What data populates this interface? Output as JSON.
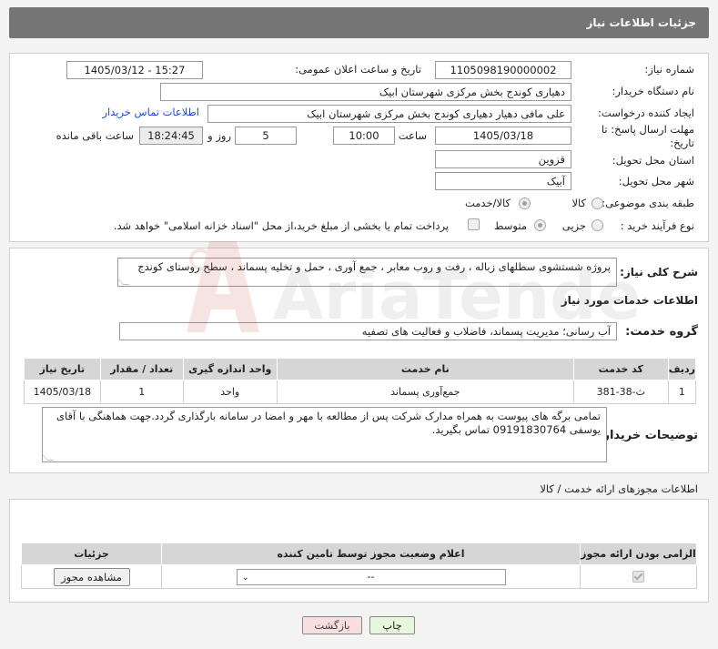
{
  "header": {
    "title": "جزئیات اطلاعات نیاز"
  },
  "form": {
    "need_number_label": "شماره نیاز:",
    "need_number": "1105098190000002",
    "announce_label": "تاریخ و ساعت اعلان عمومی:",
    "announce_value": "1405/03/12 - 15:27",
    "buyer_org_label": "نام دستگاه خریدار:",
    "buyer_org": "دهیاری کوندج بخش مرکزی شهرستان ابیک",
    "requester_label": "ایجاد کننده درخواست:",
    "requester": "علی مافی دهیار دهیاری کوندج بخش مرکزی شهرستان ابیک",
    "contact_link": "اطلاعات تماس خریدار",
    "deadline_label_1": "مهلت ارسال پاسخ: تا",
    "deadline_label_2": "تاریخ:",
    "deadline_date": "1405/03/18",
    "time_label": "ساعت",
    "deadline_time": "10:00",
    "days_value": "5",
    "days_label": "روز و",
    "remaining_time": "18:24:45",
    "remaining_label": "ساعت باقی مانده",
    "province_label": "استان محل تحویل:",
    "province": "قزوین",
    "city_label": "شهر محل تحویل:",
    "city": "آبیک",
    "category_label": "طبقه بندی موضوعی:",
    "category_options": [
      "کالا",
      "کالا/خدمت"
    ],
    "process_label": "نوع فرآیند خرید :",
    "process_options": [
      "جزیی",
      "متوسط"
    ],
    "payment_note": "پرداخت تمام یا بخشی از مبلغ خرید،از محل \"اسناد خزانه اسلامی\" خواهد شد."
  },
  "description": {
    "label": "شرح کلی نیاز:",
    "text": "پروژه شستشوی سطلهای زباله ، رفت و روب معابر ، جمع آوری ، حمل و تخلیه پسماند ، سطح روستای کوندج"
  },
  "services": {
    "section_title": "اطلاعات خدمات مورد نیاز",
    "group_label": "گروه خدمت:",
    "group_value": "آب رسانی؛ مدیریت پسماند، فاضلاب و فعالیت های تصفیه",
    "columns": [
      "ردیف",
      "کد خدمت",
      "نام خدمت",
      "واحد اندازه گیری",
      "تعداد / مقدار",
      "تاریخ نیاز"
    ],
    "rows": [
      [
        "1",
        "ث-38-381",
        "جمع‌آوری پسماند",
        "واحد",
        "1",
        "1405/03/18"
      ]
    ]
  },
  "buyer_notes": {
    "label": "توضیحات خریدار:",
    "text": "تمامی برگه های پیوست به همراه مدارک شرکت پس از مطالعه با مهر و امضا در سامانه بارگذاری گردد.جهت هماهنگی با آقای یوسفی 09191830764 تماس بگیرید."
  },
  "permits": {
    "title": "اطلاعات مجوزهای ارائه خدمت / کالا",
    "columns": [
      "الزامی بودن ارائه مجوز",
      "اعلام وضعیت مجوز توسط تامین کننده",
      "جزئیات"
    ],
    "select_value": "--",
    "view_button": "مشاهده مجوز"
  },
  "actions": {
    "print": "چاپ",
    "back": "بازگشت"
  },
  "watermark": {
    "text": "AriaTender.net"
  },
  "colors": {
    "header_bg": "#757575",
    "link": "#1a4fd6",
    "print_btn": "#e8f7dc",
    "back_btn": "#f8dede"
  }
}
